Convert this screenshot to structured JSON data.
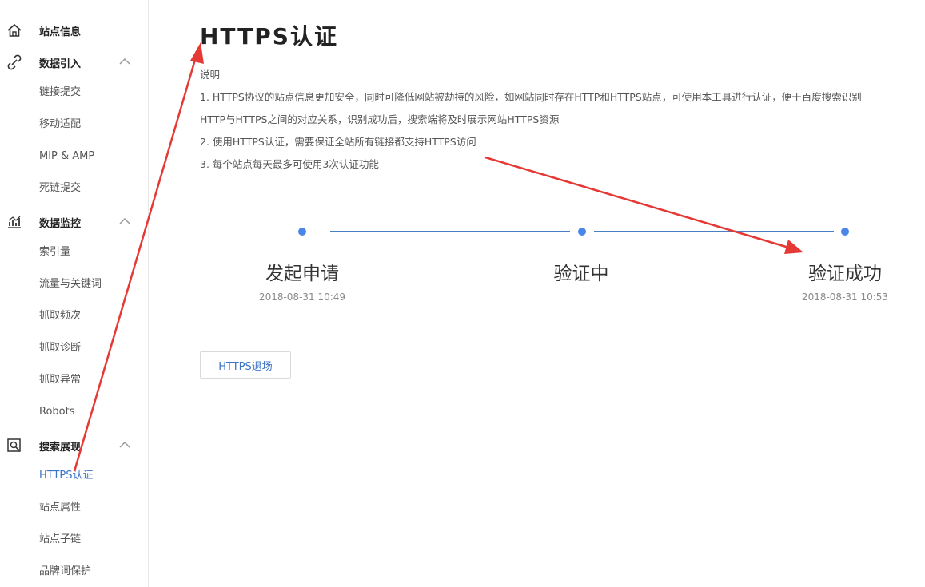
{
  "sidebar": {
    "groups": [
      {
        "label": "站点信息",
        "icon": "home-icon",
        "items": []
      },
      {
        "label": "数据引入",
        "icon": "link-icon",
        "items": [
          "链接提交",
          "移动适配",
          "MIP & AMP",
          "死链提交"
        ]
      },
      {
        "label": "数据监控",
        "icon": "chart-icon",
        "items": [
          "索引量",
          "流量与关键词",
          "抓取频次",
          "抓取诊断",
          "抓取异常",
          "Robots"
        ]
      },
      {
        "label": "搜索展现",
        "icon": "search-display-icon",
        "items": [
          "HTTPS认证",
          "站点属性",
          "站点子链",
          "品牌词保护"
        ]
      }
    ],
    "active_item": "HTTPS认证"
  },
  "main": {
    "title": "HTTPS认证",
    "description": {
      "heading": "说明",
      "lines": [
        "1. HTTPS协议的站点信息更加安全，同时可降低网站被劫持的风险，如网站同时存在HTTP和HTTPS站点，可使用本工具进行认证，便于百度搜索识别",
        "HTTP与HTTPS之间的对应关系，识别成功后，搜索端将及时展示网站HTTPS资源",
        "2. 使用HTTPS认证，需要保证全站所有链接都支持HTTPS访问",
        "3. 每个站点每天最多可使用3次认证功能"
      ]
    },
    "steps": [
      {
        "label": "发起申请",
        "time": "2018-08-31 10:49"
      },
      {
        "label": "验证中",
        "time": ""
      },
      {
        "label": "验证成功",
        "time": "2018-08-31 10:53"
      }
    ],
    "exit_button": "HTTPS退场"
  },
  "colors": {
    "accent": "#3b73c9",
    "step_dot": "#4a86e8",
    "annotation_arrow": "#e53935"
  }
}
